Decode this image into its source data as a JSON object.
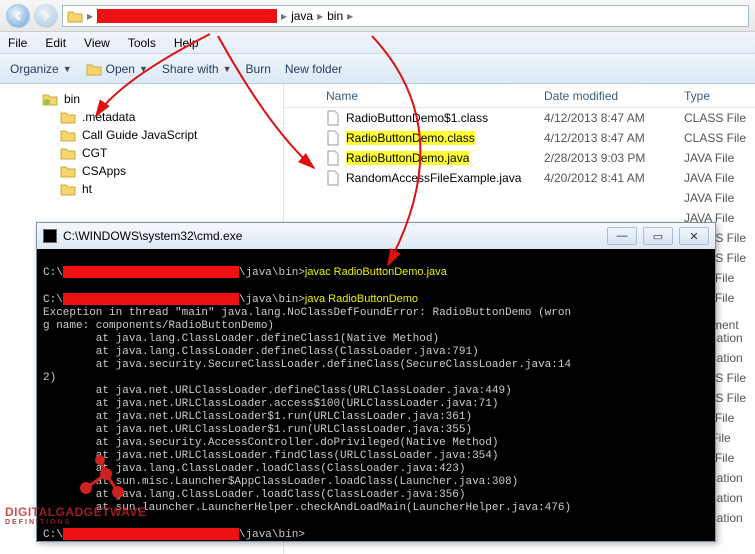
{
  "address": {
    "crumb1": "java",
    "crumb2": "bin"
  },
  "menu": {
    "file": "File",
    "edit": "Edit",
    "view": "View",
    "tools": "Tools",
    "help": "Help"
  },
  "toolbar": {
    "organize": "Organize",
    "open": "Open",
    "share": "Share with",
    "burn": "Burn",
    "newfolder": "New folder"
  },
  "tree": {
    "items": [
      {
        "label": "bin"
      },
      {
        "label": ".metadata"
      },
      {
        "label": "Call Guide JavaScript"
      },
      {
        "label": "CGT"
      },
      {
        "label": "CSApps"
      },
      {
        "label": "ht"
      }
    ]
  },
  "columns": {
    "name": "Name",
    "date": "Date modified",
    "type": "Type"
  },
  "files": [
    {
      "name": "RadioButtonDemo$1.class",
      "date": "4/12/2013 8:47 AM",
      "type": "CLASS File",
      "hl": false
    },
    {
      "name": "RadioButtonDemo.class",
      "date": "4/12/2013 8:47 AM",
      "type": "CLASS File",
      "hl": true
    },
    {
      "name": "RadioButtonDemo.java",
      "date": "2/28/2013 9:03 PM",
      "type": "JAVA File",
      "hl": true
    },
    {
      "name": "RandomAccessFileExample.java",
      "date": "4/20/2012 8:41 AM",
      "type": "JAVA File",
      "hl": false
    }
  ],
  "extra_types": [
    "JAVA File",
    "JAVA File",
    "CLASS File",
    "CLASS File",
    "JAVA File",
    "JAVA File",
    "Text Document",
    "Application",
    "Application",
    "CLASS File",
    "CLASS File",
    "JAVA File",
    "BAK File",
    "JAVA File",
    "Application",
    "Application",
    "Application"
  ],
  "cmd": {
    "title": "C:\\WINDOWS\\system32\\cmd.exe",
    "prompt_prefix": "C:\\",
    "path_tail": "\\java\\bin>",
    "cmd1": "javac RadioButtonDemo.java",
    "cmd2": "java RadioButtonDemo",
    "err_head": "Exception in thread \"main\" java.lang.NoClassDefFoundError: RadioButtonDemo (wron",
    "err_head2": "g name: components/RadioButtonDemo)",
    "trace": [
      "        at java.lang.ClassLoader.defineClass1(Native Method)",
      "        at java.lang.ClassLoader.defineClass(ClassLoader.java:791)",
      "        at java.security.SecureClassLoader.defineClass(SecureClassLoader.java:14",
      "2)",
      "        at java.net.URLClassLoader.defineClass(URLClassLoader.java:449)",
      "        at java.net.URLClassLoader.access$100(URLClassLoader.java:71)",
      "        at java.net.URLClassLoader$1.run(URLClassLoader.java:361)",
      "        at java.net.URLClassLoader$1.run(URLClassLoader.java:355)",
      "        at java.security.AccessController.doPrivileged(Native Method)",
      "        at java.net.URLClassLoader.findClass(URLClassLoader.java:354)",
      "        at java.lang.ClassLoader.loadClass(ClassLoader.java:423)",
      "        at sun.misc.Launcher$AppClassLoader.loadClass(Launcher.java:308)",
      "        at java.lang.ClassLoader.loadClass(ClassLoader.java:356)",
      "        at sun.launcher.LauncherHelper.checkAndLoadMain(LauncherHelper.java:476)"
    ],
    "final_prompt": "\\java\\bin>"
  },
  "watermark": {
    "line1": "DIGITALGADGETWAVE",
    "line2": "DEFINITIONS"
  }
}
